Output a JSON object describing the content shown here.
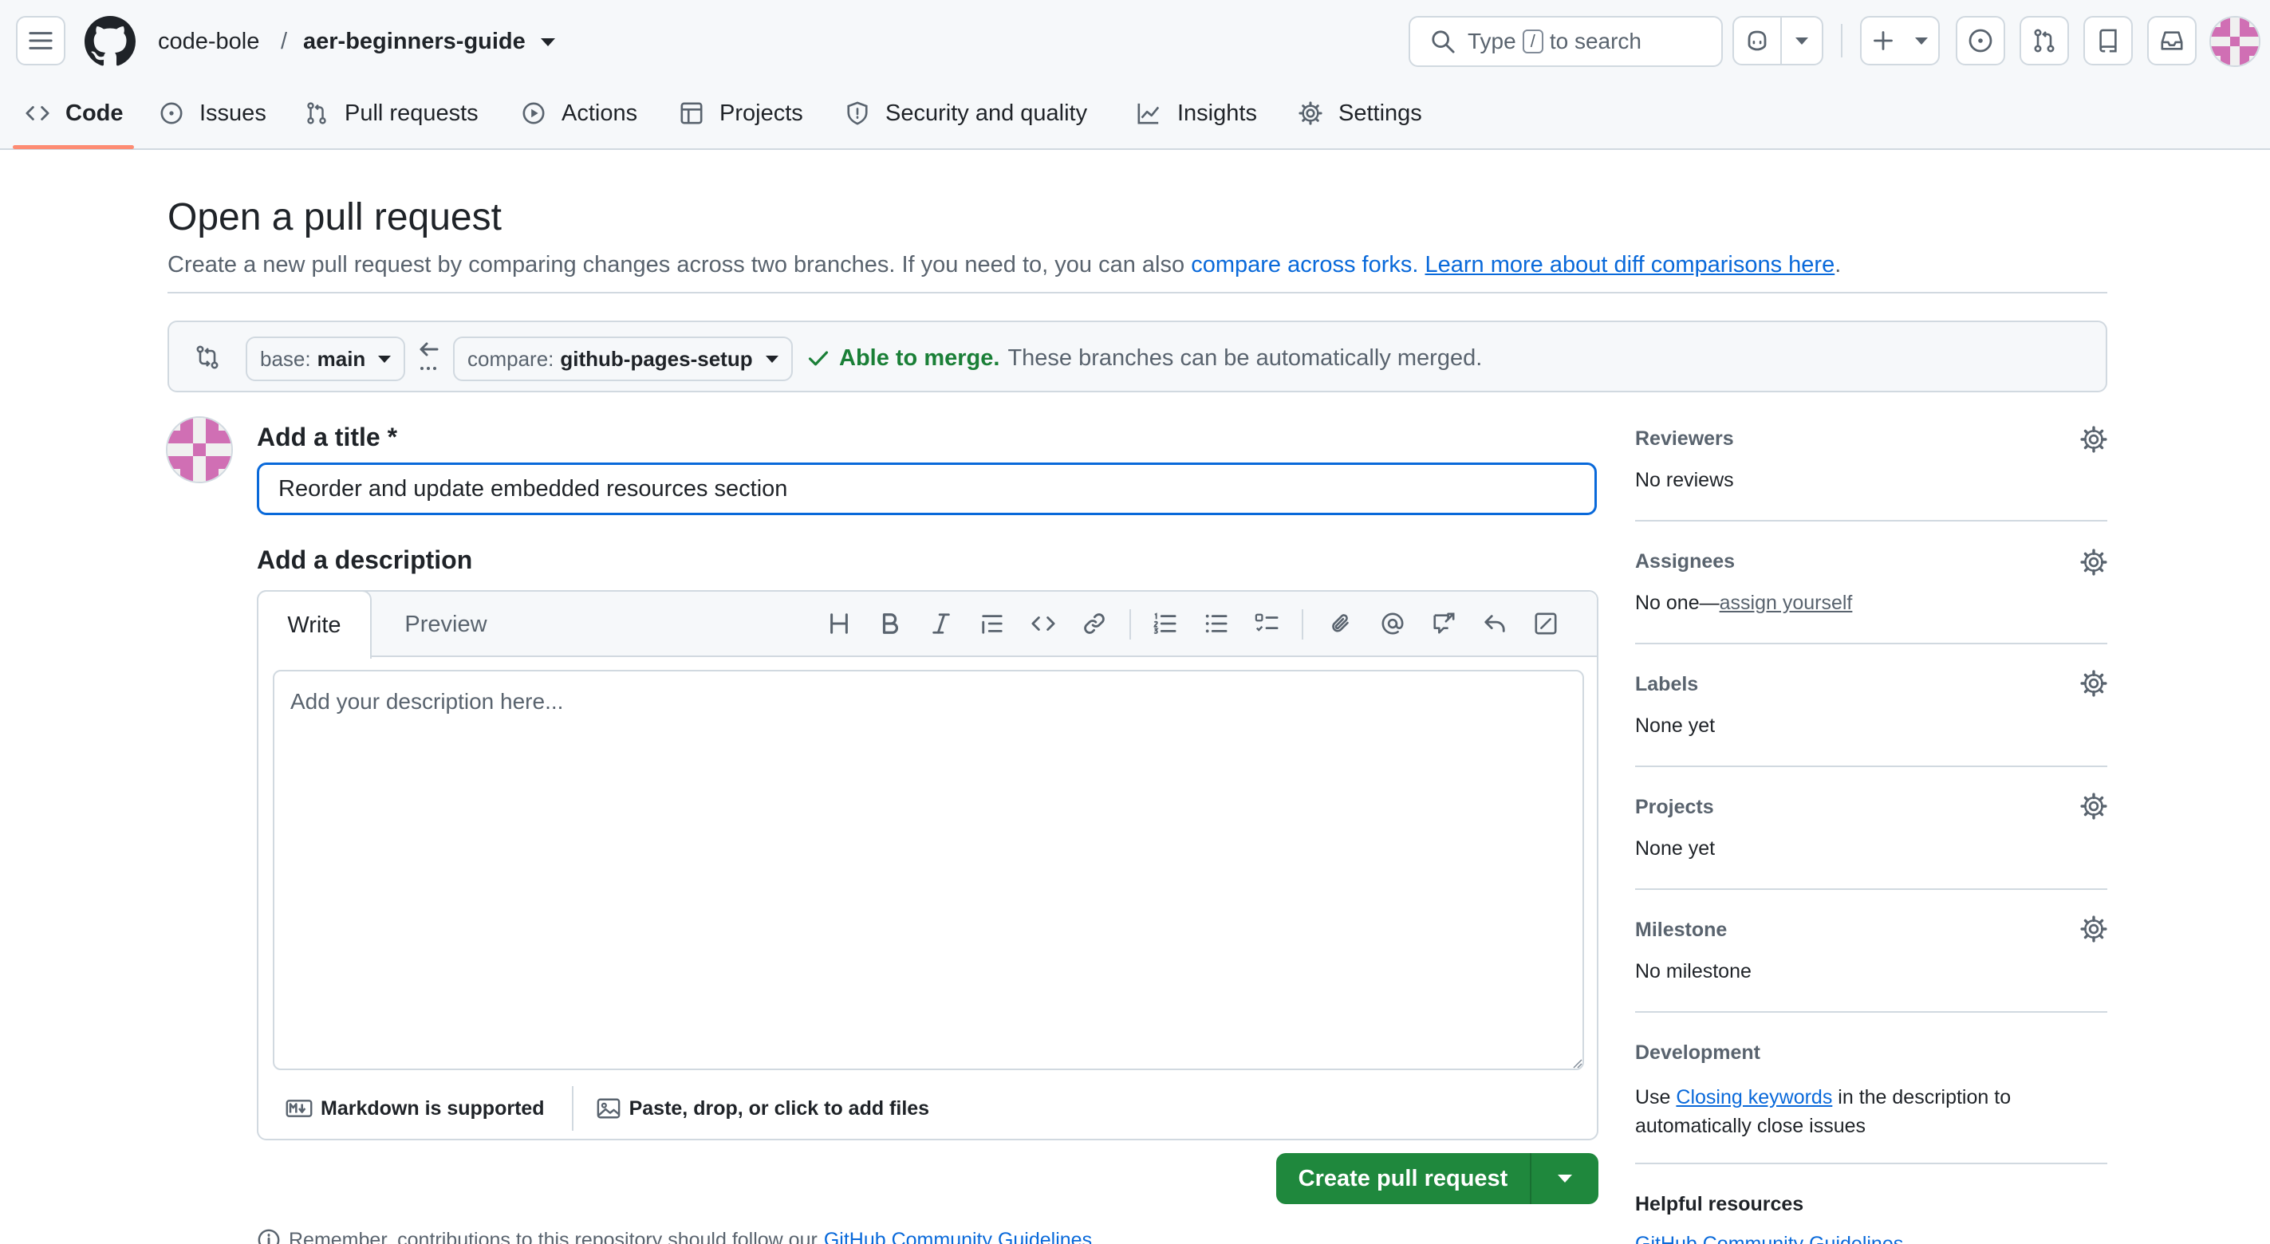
{
  "header": {
    "owner": "code-bole",
    "separator": "/",
    "repo": "aer-beginners-guide",
    "search": {
      "prefix": "Type",
      "key": "/",
      "suffix": "to search"
    }
  },
  "repo_nav": {
    "tabs": [
      {
        "label": "Code",
        "icon": "code-icon",
        "active": true
      },
      {
        "label": "Issues",
        "icon": "issue-opened-icon"
      },
      {
        "label": "Pull requests",
        "icon": "git-pull-request-icon"
      },
      {
        "label": "Actions",
        "icon": "play-icon"
      },
      {
        "label": "Projects",
        "icon": "table-icon"
      },
      {
        "label": "Security and quality",
        "icon": "shield-icon"
      },
      {
        "label": "Insights",
        "icon": "graph-icon"
      },
      {
        "label": "Settings",
        "icon": "gear-icon"
      }
    ]
  },
  "page": {
    "title": "Open a pull request",
    "subtitle_text": "Create a new pull request by comparing changes across two branches. If you need to, you can also",
    "subtitle_link1": "compare across forks.",
    "subtitle_link2": "Learn more about diff comparisons here",
    "subtitle_end": "."
  },
  "compare": {
    "base_label": "base:",
    "base_value": "main",
    "compare_label": "compare:",
    "compare_value": "github-pages-setup",
    "merge_status": "Able to merge.",
    "merge_detail": "These branches can be automatically merged."
  },
  "form": {
    "title_heading": "Add a title",
    "required_mark": "*",
    "title_value": "Reorder and update embedded resources section",
    "desc_heading": "Add a description",
    "tab_write": "Write",
    "tab_preview": "Preview",
    "desc_placeholder": "Add your description here...",
    "markdown_note": "Markdown is supported",
    "files_note": "Paste, drop, or click to add files",
    "submit_label": "Create pull request",
    "footnote_text": "Remember, contributions to this repository should follow our",
    "footnote_link": "GitHub Community Guidelines."
  },
  "sidebar": {
    "reviewers": {
      "heading": "Reviewers",
      "value": "No reviews"
    },
    "assignees": {
      "heading": "Assignees",
      "value": "No one—",
      "link": "assign yourself"
    },
    "labels": {
      "heading": "Labels",
      "value": "None yet"
    },
    "projects": {
      "heading": "Projects",
      "value": "None yet"
    },
    "milestone": {
      "heading": "Milestone",
      "value": "No milestone"
    },
    "development": {
      "heading": "Development",
      "prefix": "Use",
      "link": "Closing keywords",
      "suffix": "in the description to",
      "line2": "automatically close issues"
    },
    "helpful": {
      "heading": "Helpful resources",
      "link": "GitHub Community Guidelines"
    }
  },
  "colors": {
    "accent": "#0969da",
    "success": "#1a7f37",
    "button": "#1f883d",
    "tab_underline": "#fd8c73"
  }
}
